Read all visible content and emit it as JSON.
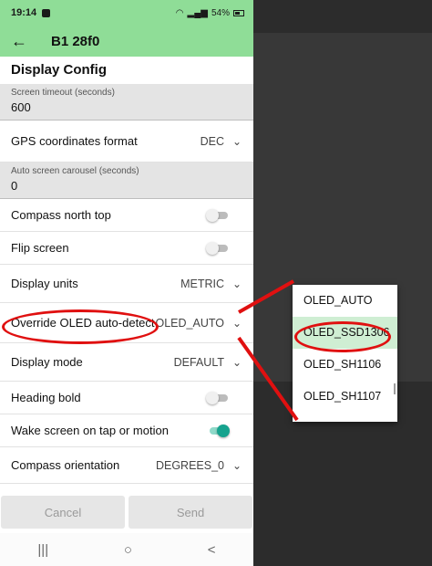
{
  "status_bar": {
    "time": "19:14",
    "battery": "54%",
    "icons": [
      "wifi-icon",
      "signal-icon",
      "battery-icon"
    ]
  },
  "app_bar": {
    "back_icon": "back-arrow-icon",
    "title": "B1 28f0"
  },
  "section_title": "Display Config",
  "screen_timeout": {
    "label": "Screen timeout (seconds)",
    "value": "600"
  },
  "gps_format": {
    "label": "GPS coordinates format",
    "value": "DEC"
  },
  "auto_carousel": {
    "label": "Auto screen carousel (seconds)",
    "value": "0"
  },
  "compass_north_top": {
    "label": "Compass north top",
    "on": false
  },
  "flip_screen": {
    "label": "Flip screen",
    "on": false
  },
  "display_units": {
    "label": "Display units",
    "value": "METRIC"
  },
  "override_oled": {
    "label": "Override OLED auto-detect",
    "value": "OLED_AUTO"
  },
  "display_mode": {
    "label": "Display mode",
    "value": "DEFAULT"
  },
  "heading_bold": {
    "label": "Heading bold",
    "on": false
  },
  "wake_screen": {
    "label": "Wake screen on tap or motion",
    "on": true
  },
  "compass_orientation": {
    "label": "Compass orientation",
    "value": "DEGREES_0"
  },
  "buttons": {
    "cancel": "Cancel",
    "send": "Send"
  },
  "nav": {
    "recents": "|||",
    "home": "○",
    "back": "<"
  },
  "dropdown": {
    "options": [
      "OLED_AUTO",
      "OLED_SSD1306",
      "OLED_SH1106",
      "OLED_SH1107"
    ],
    "selected": "OLED_SSD1306"
  },
  "colors": {
    "app_bar": "#8fdd97",
    "accent_toggle": "#16a38e",
    "annotation": "#e01010",
    "selected_option": "#cfeed3"
  }
}
